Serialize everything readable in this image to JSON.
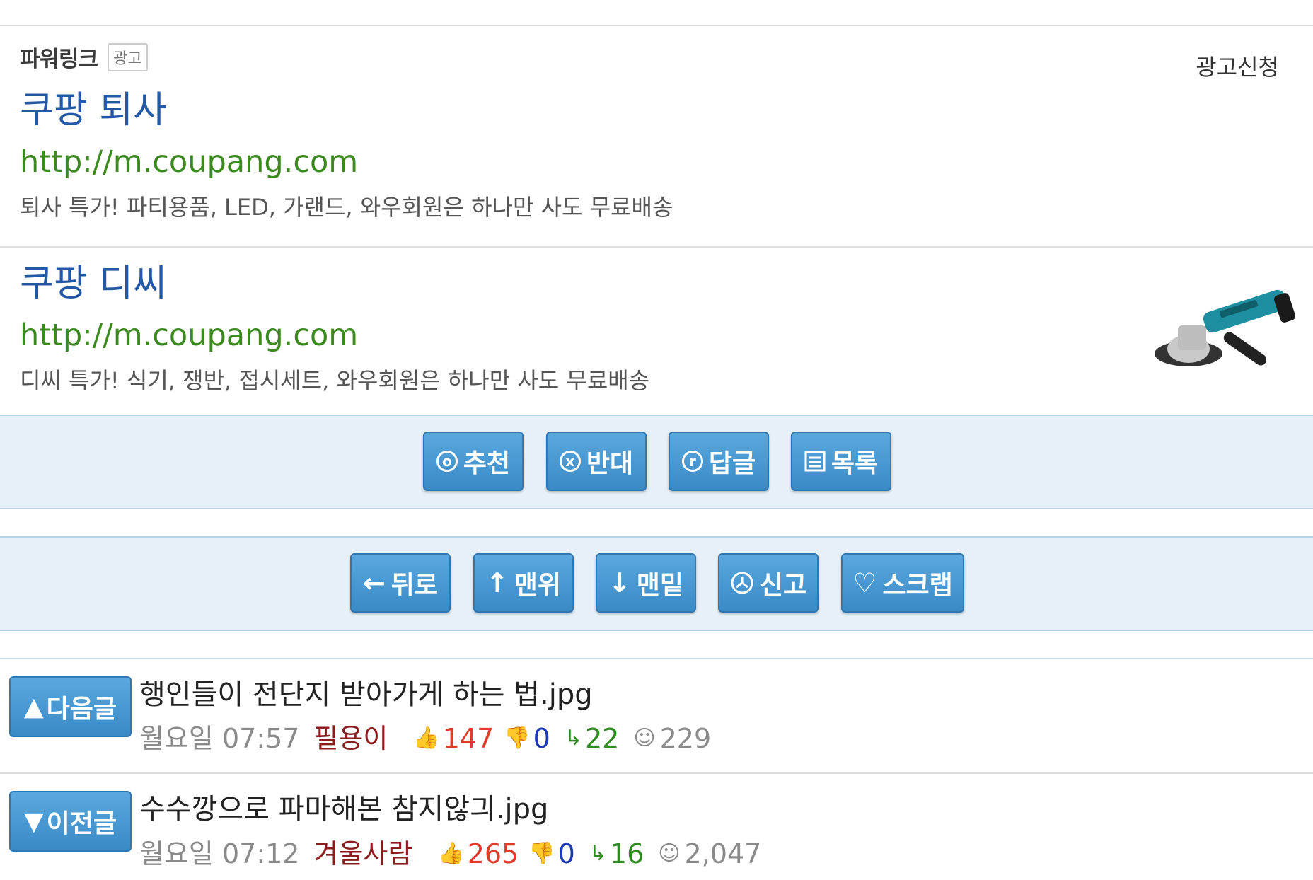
{
  "ad_section": {
    "title": "파워링크",
    "badge": "광고",
    "apply_link": "광고신청",
    "items": [
      {
        "title": "쿠팡 퇴사",
        "url": "http://m.coupang.com",
        "desc": "퇴사 특가! 파티용품, LED, 가랜드, 와우회원은 하나만 사도 무료배송"
      },
      {
        "title": "쿠팡 디씨",
        "url": "http://m.coupang.com",
        "desc": "디씨 특가! 식기, 쟁반, 접시세트, 와우회원은 하나만 사도 무료배송"
      }
    ]
  },
  "action_bar": {
    "buttons": [
      {
        "label": "추천",
        "icon": "o"
      },
      {
        "label": "반대",
        "icon": "x"
      },
      {
        "label": "답글",
        "icon": "r"
      },
      {
        "label": "목록",
        "icon": "list"
      }
    ]
  },
  "nav_bar": {
    "buttons": [
      {
        "label": "뒤로",
        "icon": "←"
      },
      {
        "label": "맨위",
        "icon": "↑"
      },
      {
        "label": "맨밑",
        "icon": "↓"
      },
      {
        "label": "신고",
        "icon": "report"
      },
      {
        "label": "스크랩",
        "icon": "♡"
      }
    ]
  },
  "posts": [
    {
      "nav_label": "다음글",
      "nav_icon": "▲",
      "title": "행인들이 전단지 받아가게 하는 법.jpg",
      "date": "월요일 07:57",
      "author": "필용이",
      "up": "147",
      "down": "0",
      "replies": "22",
      "views": "229"
    },
    {
      "nav_label": "이전글",
      "nav_icon": "▼",
      "title": "수수깡으로 파마해본 참지않긔.jpg",
      "date": "월요일 07:12",
      "author": "겨울사람",
      "up": "265",
      "down": "0",
      "replies": "16",
      "views": "2,047"
    }
  ],
  "colors": {
    "link_blue": "#2358a6",
    "url_green": "#3c8a1f",
    "button_blue": "#3a8ac6",
    "bar_bg": "#e6f0f8"
  }
}
